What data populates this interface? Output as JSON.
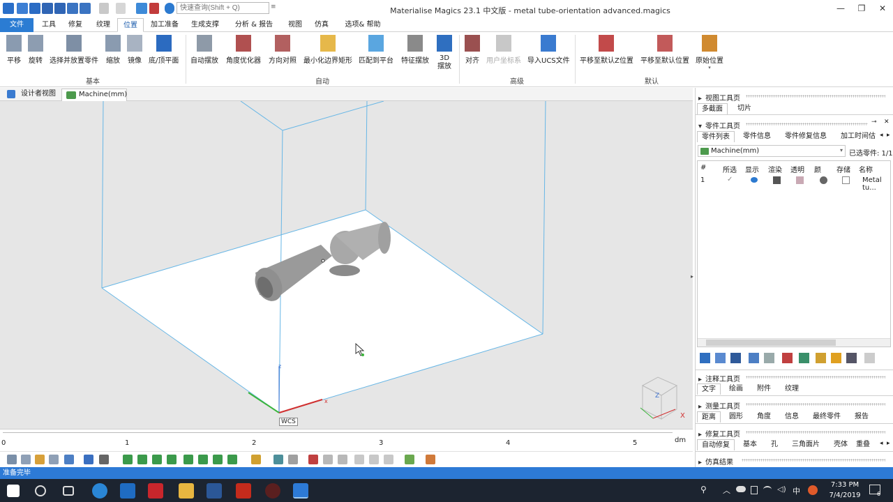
{
  "app": {
    "title": "Materialise Magics 23.1 中文版 - metal tube-orientation advanced.magics",
    "search_placeholder": "快速查询(Shift + Q)"
  },
  "window_controls": {
    "minimize": "—",
    "restore": "❐",
    "close": "✕"
  },
  "menu_tabs": [
    "文件",
    "工具",
    "修复",
    "纹理",
    "位置",
    "加工准备",
    "生成支撑",
    "分析 & 报告",
    "视图",
    "仿真",
    "选项& 帮助"
  ],
  "ribbon": {
    "groups": [
      "基本",
      "自动",
      "高级",
      "默认"
    ],
    "buttons": [
      "平移",
      "旋转",
      "选择并放置零件",
      "缩放",
      "镜像",
      "底/顶平面",
      "自动摆放",
      "角度优化器",
      "方向对照",
      "最小化边界矩形",
      "匹配到平台",
      "特征摆放",
      "3D 摆放",
      "对齐",
      "用户坐标系",
      "导入UCS文件",
      "平移至默认Z位置",
      "平移至默认位置",
      "原始位置"
    ]
  },
  "view_tabs": [
    "设计者视图",
    "Machine(mm)"
  ],
  "viewport": {
    "wcs": "WCS",
    "axis_x": "x",
    "axis_z": "z",
    "cube_z": "Z",
    "cube_x": "X"
  },
  "ruler": {
    "ticks": [
      "0",
      "1",
      "2",
      "3",
      "4",
      "5"
    ],
    "unit": "dm"
  },
  "status": "准备完毕",
  "taskbar": {
    "time": "7:33 PM",
    "date": "7/4/2019",
    "ime": "中",
    "notif_count": "6"
  },
  "panel": {
    "view_toolbar": {
      "title": "视图工具页",
      "tabs": [
        "多截面",
        "切片"
      ]
    },
    "part_toolbar": {
      "title": "零件工具页",
      "tabs": [
        "零件列表",
        "零件信息",
        "零件修复信息",
        "加工时间估"
      ],
      "scene": "Machine(mm)",
      "selected": "已选零件: 1/1",
      "columns": [
        "#",
        "所选",
        "显示",
        "渲染",
        "透明",
        "颜",
        "存储",
        "名称"
      ],
      "rows": [
        {
          "num": "1",
          "check": "✓",
          "name": "Metal tu..."
        }
      ]
    },
    "annotation_toolbar": {
      "title": "注释工具页",
      "tabs": [
        "文字",
        "绘画",
        "附件",
        "纹理"
      ]
    },
    "measure_toolbar": {
      "title": "测量工具页",
      "tabs": [
        "距离",
        "圆形",
        "角度",
        "信息",
        "最终零件",
        "报告"
      ]
    },
    "repair_toolbar": {
      "title": "修复工具页",
      "tabs": [
        "自动修复",
        "基本",
        "孔",
        "三角面片",
        "壳体",
        "重叠"
      ]
    },
    "sim_results": {
      "title": "仿真结果"
    }
  },
  "colors": {
    "accent": "#2b7cd3",
    "status": "#2d7ad6"
  }
}
